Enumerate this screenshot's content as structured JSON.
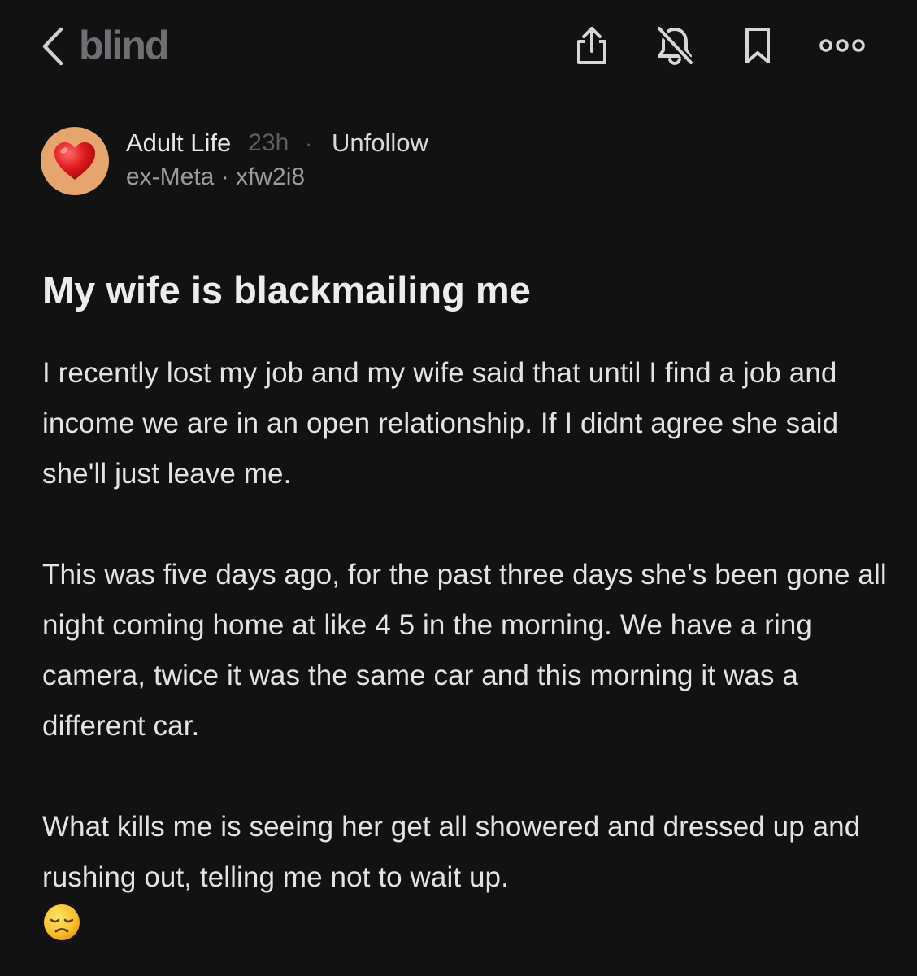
{
  "header": {
    "brand": "blind",
    "back_icon": "chevron-left-icon",
    "actions": [
      {
        "name": "share",
        "icon": "share-icon"
      },
      {
        "name": "mute-notifications",
        "icon": "bell-off-icon"
      },
      {
        "name": "bookmark",
        "icon": "bookmark-icon"
      },
      {
        "name": "more",
        "icon": "more-icon"
      }
    ]
  },
  "author": {
    "avatar_icon": "heart-icon",
    "avatar_bg": "#e6a46e",
    "channel": "Adult Life",
    "time": "23h",
    "separator": "·",
    "follow_label": "Unfollow",
    "company": "ex-Meta",
    "meta_separator": " · ",
    "username": "xfw2i8"
  },
  "post": {
    "title": "My wife is blackmailing me",
    "paragraphs": [
      "I recently lost my job and my wife said that until I find a job and income we are in an open relationship. If I didnt agree she said she'll just leave me.",
      "This was five days ago, for the past three days she's been gone all night coming home at like 4 5 in the morning. We have a ring camera, twice it was the same car and this morning it was a different car.",
      "What kills me is seeing her get all showered and dressed up and rushing out, telling me not to wait up."
    ],
    "trailing_emoji": "disappointed-face-emoji"
  },
  "colors": {
    "background": "#121212",
    "text": "#e3e3e3",
    "muted": "#5e5e63",
    "secondary": "#9a9a9f"
  }
}
